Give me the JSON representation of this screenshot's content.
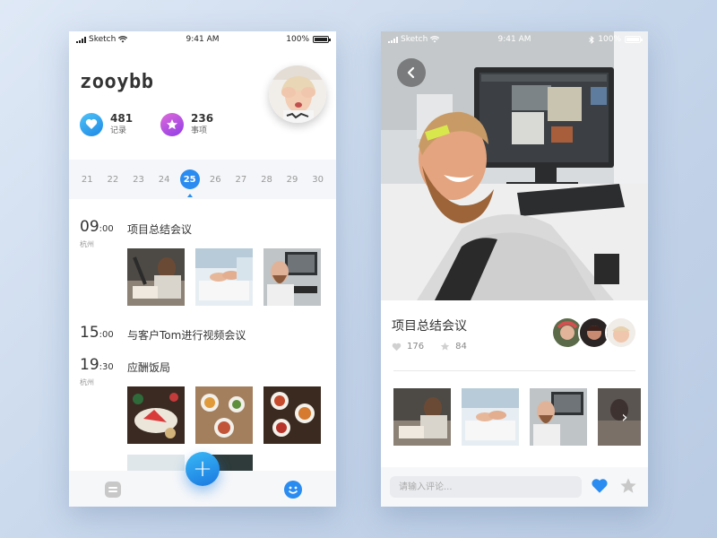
{
  "left": {
    "status": {
      "carrier": "Sketch",
      "time": "9:41 AM",
      "battery": "100%"
    },
    "username": "zooybb",
    "stats": [
      {
        "value": "481",
        "label": "记录",
        "icon": "heart-icon",
        "color": "#2a9bf2"
      },
      {
        "value": "236",
        "label": "事项",
        "icon": "star-icon",
        "color": "#b14ee6"
      }
    ],
    "dates": [
      "21",
      "22",
      "23",
      "24",
      "25",
      "26",
      "27",
      "28",
      "29",
      "30"
    ],
    "selected_date": "25",
    "events": [
      {
        "hour": "09",
        "minute": ":00",
        "city": "杭州",
        "title": "项目总结会议"
      },
      {
        "hour": "15",
        "minute": ":00",
        "city": "",
        "title": "与客户Tom进行视频会议"
      },
      {
        "hour": "19",
        "minute": ":30",
        "city": "杭州",
        "title": "应酬饭局"
      }
    ],
    "fab_label": "+"
  },
  "right": {
    "status": {
      "carrier": "Sketch",
      "time": "9:41 AM",
      "battery": "100%"
    },
    "title": "项目总结会议",
    "likes": "176",
    "stars": "84",
    "comment_placeholder": "请输入评论...",
    "next_icon": "›"
  },
  "colors": {
    "accent": "#2a8cf0",
    "purple": "#b14ee6",
    "background": "#c5d5ea"
  }
}
